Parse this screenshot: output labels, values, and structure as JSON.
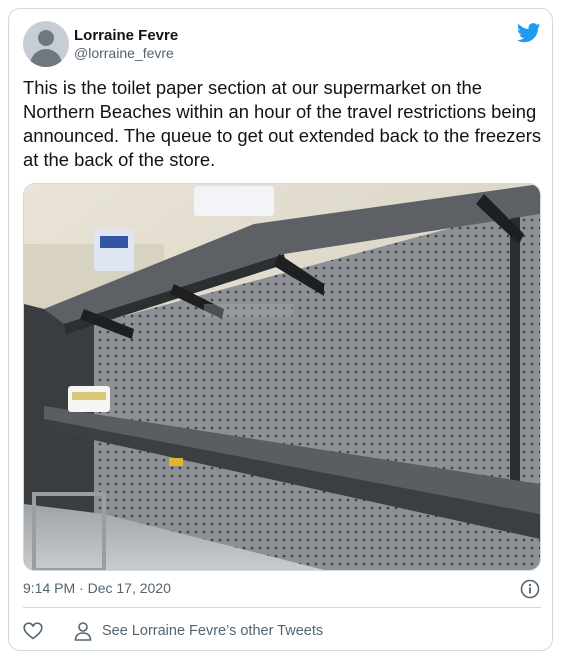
{
  "tweet": {
    "author_name": "Lorraine Fevre",
    "author_handle": "@lorraine_fevre",
    "text": "This is the toilet paper section at our supermarket on the Northern Beaches within an hour of the travel restrictions being announced. The queue to get out extended back to the freezers at the back of the store.",
    "timestamp": "9:14 PM · Dec 17, 2020",
    "see_more_label": "See Lorraine Fevre’s other Tweets"
  },
  "icons": {
    "brand": "twitter-bird-icon",
    "info": "info-icon",
    "like": "heart-icon",
    "profile": "person-icon"
  },
  "colors": {
    "brand": "#1d9bf0",
    "text_primary": "#0f1419",
    "text_secondary": "#536471",
    "border": "#cfd9de"
  }
}
